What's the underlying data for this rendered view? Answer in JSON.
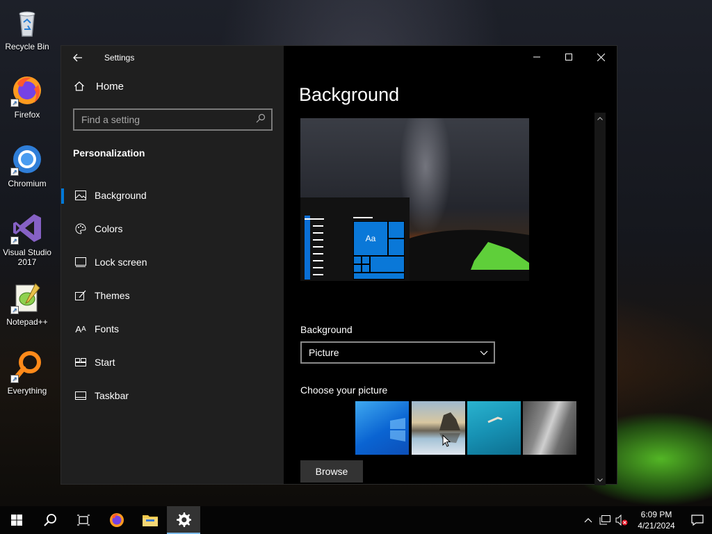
{
  "desktop": {
    "icons": [
      {
        "label": "Recycle Bin",
        "icon": "recycle-bin-icon"
      },
      {
        "label": "Firefox",
        "icon": "firefox-icon"
      },
      {
        "label": "Chromium",
        "icon": "chromium-icon"
      },
      {
        "label": "Visual Studio 2017",
        "icon": "visual-studio-icon"
      },
      {
        "label": "Notepad++",
        "icon": "notepadpp-icon"
      },
      {
        "label": "Everything",
        "icon": "everything-icon"
      }
    ]
  },
  "window": {
    "app_title": "Settings",
    "home_label": "Home",
    "search_placeholder": "Find a setting",
    "section_title": "Personalization",
    "nav_items": [
      {
        "label": "Background",
        "icon": "picture-icon",
        "active": true
      },
      {
        "label": "Colors",
        "icon": "palette-icon",
        "active": false
      },
      {
        "label": "Lock screen",
        "icon": "lock-screen-icon",
        "active": false
      },
      {
        "label": "Themes",
        "icon": "themes-icon",
        "active": false
      },
      {
        "label": "Fonts",
        "icon": "fonts-icon",
        "active": false
      },
      {
        "label": "Start",
        "icon": "start-icon",
        "active": false
      },
      {
        "label": "Taskbar",
        "icon": "taskbar-icon",
        "active": false
      }
    ],
    "page_title": "Background",
    "preview_tile_text": "Aa",
    "background_label": "Background",
    "background_value": "Picture",
    "choose_label": "Choose your picture",
    "browse_label": "Browse"
  },
  "taskbar": {
    "time": "6:09 PM",
    "date": "4/21/2024"
  },
  "colors": {
    "accent": "#0078d7",
    "nav_bg": "#1f1f1f",
    "content_bg": "#000000"
  }
}
